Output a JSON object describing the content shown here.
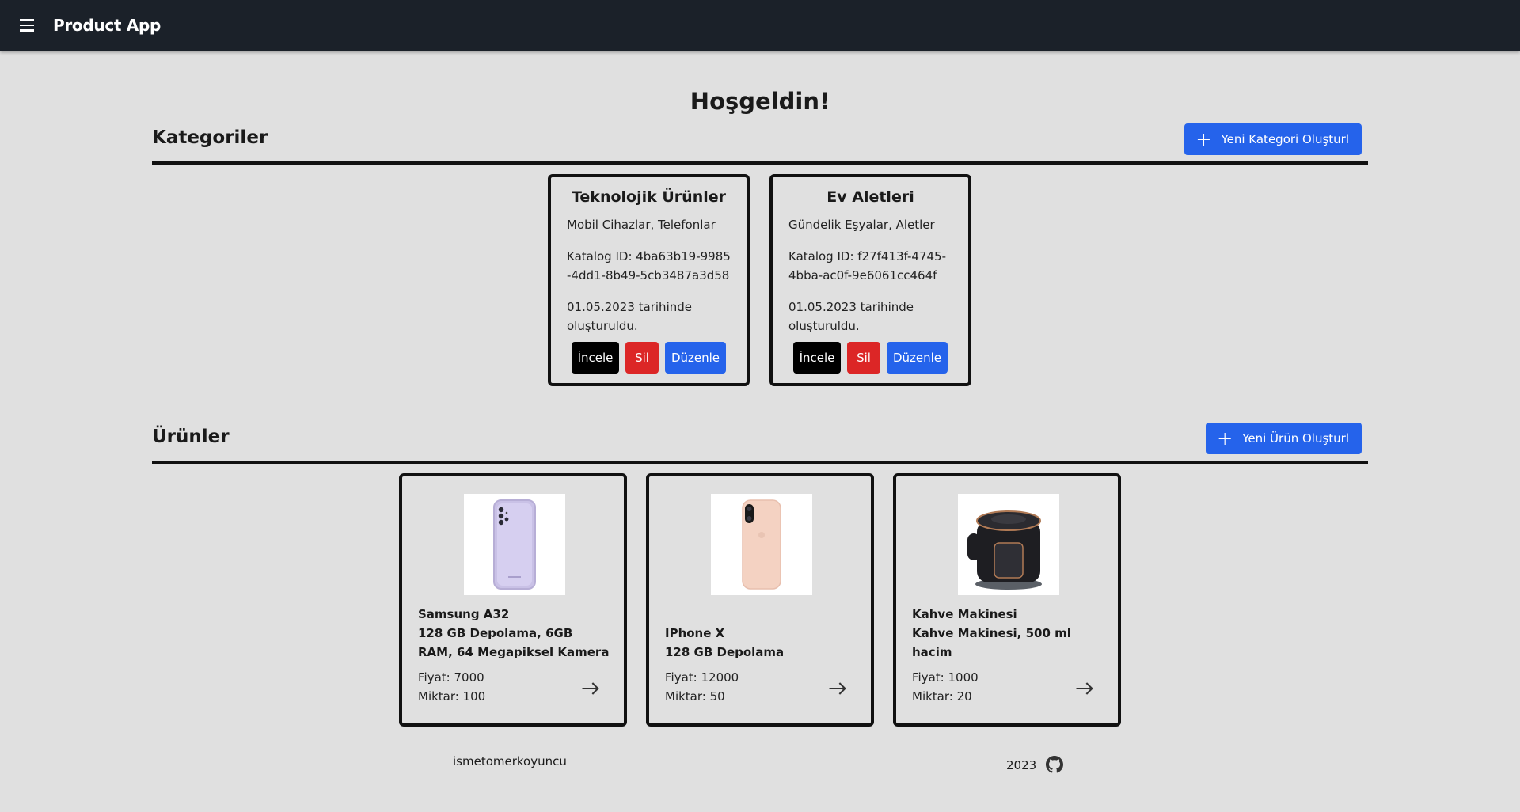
{
  "appbar": {
    "title": "Product App",
    "menu_icon": "hamburger-menu-icon"
  },
  "greeting": "Hoşgeldin!",
  "categories_section": {
    "title": "Kategoriler",
    "create_button": "Yeni Kategori Oluşturl",
    "items": [
      {
        "name": "Teknolojik Ürünler",
        "description": "Mobil Cihazlar, Telefonlar",
        "catalog_id": "Katalog ID: 4ba63b19-9985-4dd1-8b49-5cb3487a3d58",
        "created": "01.05.2023 tarihinde oluşturuldu.",
        "inspect": "İncele",
        "delete": "Sil",
        "edit": "Düzenle"
      },
      {
        "name": "Ev Aletleri",
        "description": "Gündelik Eşyalar, Aletler",
        "catalog_id": "Katalog ID: f27f413f-4745-4bba-ac0f-9e6061cc464f",
        "created": "01.05.2023 tarihinde oluşturuldu.",
        "inspect": "İncele",
        "delete": "Sil",
        "edit": "Düzenle"
      }
    ]
  },
  "products_section": {
    "title": "Ürünler",
    "create_button": "Yeni Ürün Oluşturl",
    "items": [
      {
        "name": "Samsung A32",
        "description": "128 GB Depolama, 6GB RAM, 64 Megapiksel Kamera",
        "price": "Fiyat: 7000",
        "quantity": "Miktar: 100",
        "image": "samsung-phone-image"
      },
      {
        "name": "IPhone X",
        "description": "128 GB Depolama",
        "price": "Fiyat: 12000",
        "quantity": "Miktar: 50",
        "image": "iphone-image"
      },
      {
        "name": "Kahve Makinesi",
        "description": "Kahve Makinesi, 500 ml hacim",
        "price": "Fiyat: 1000",
        "quantity": "Miktar: 20",
        "image": "coffee-machine-image"
      }
    ]
  },
  "footer": {
    "username": "ismetomerkoyuncu",
    "year": "2023",
    "icon": "github-icon"
  },
  "colors": {
    "appbar": "#1b2129",
    "primary": "#2563eb",
    "danger": "#dc2626",
    "dark": "#000000",
    "background": "#e0e0e0"
  }
}
